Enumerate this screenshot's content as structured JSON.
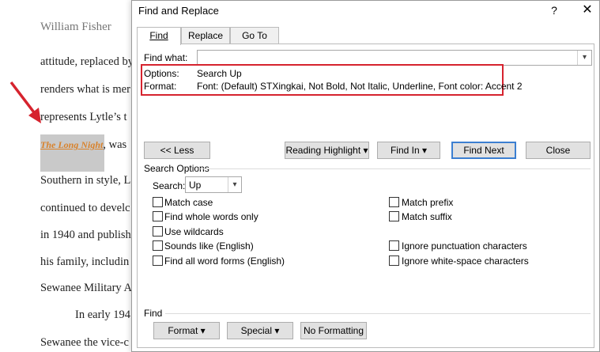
{
  "document": {
    "author": "William Fisher",
    "lines": [
      "attitude, replaced by",
      "renders what is mer",
      "represents Lytle’s t",
      ", was",
      "Southern in style, L",
      "continued to develc",
      "in 1940 and publish",
      "his family, includin",
      "Sewanee Military A",
      "In early 194",
      "Sewanee the vice-c"
    ],
    "styled_text": "The Long Night"
  },
  "dialog": {
    "title": "Find and Replace",
    "help": "?",
    "close": "✕",
    "tabs": [
      {
        "label": "Find",
        "active": true
      },
      {
        "label": "Replace",
        "active": false
      },
      {
        "label": "Go To",
        "active": false
      }
    ],
    "find_what_label": "Find what:",
    "find_what_value": "",
    "options_label": "Options:",
    "options_value": "Search Up",
    "format_label": "Format:",
    "format_value": "Font: (Default) STXingkai, Not Bold, Not Italic, Underline, Font color: Accent 2",
    "buttons": {
      "less": "<< Less",
      "reading_highlight": "Reading Highlight ▾",
      "find_in": "Find In ▾",
      "find_next": "Find Next",
      "close": "Close"
    },
    "search_options_title": "Search Options",
    "search_label": "Search:",
    "search_value": "Up",
    "left_options": [
      "Match case",
      "Find whole words only",
      "Use wildcards",
      "Sounds like (English)",
      "Find all word forms (English)"
    ],
    "right_options": [
      "Match prefix",
      "Match suffix",
      "Ignore punctuation characters",
      "Ignore white-space characters"
    ],
    "find_section_title": "Find",
    "bottom_buttons": {
      "format": "Format ▾",
      "special": "Special ▾",
      "no_formatting": "No Formatting"
    }
  },
  "colors": {
    "annotation_red": "#d6232e",
    "accent_2_orange": "#d9822b",
    "default_button_blue": "#3c7fd1"
  }
}
